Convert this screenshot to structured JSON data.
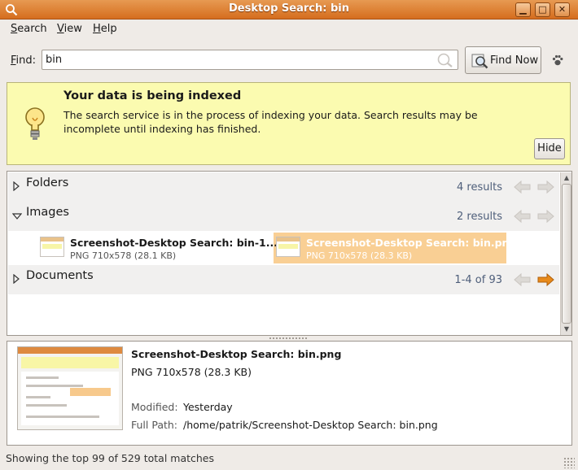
{
  "window": {
    "title": "Desktop Search: bin",
    "controls": {
      "minimize": "▁",
      "maximize": "□",
      "close": "✕"
    }
  },
  "menu": [
    {
      "label": "Search",
      "u": "S",
      "rest": "earch"
    },
    {
      "label": "View",
      "u": "V",
      "rest": "iew"
    },
    {
      "label": "Help",
      "u": "H",
      "rest": "elp"
    }
  ],
  "find": {
    "label_u": "F",
    "label_rest": "ind:",
    "value": "bin",
    "button": "Find Now"
  },
  "banner": {
    "heading": "Your data is being indexed",
    "body": "The search service is in the process of indexing your data.  Search results may be incomplete until indexing has finished.",
    "hide_button": "Hide",
    "color": "#fbfbb0"
  },
  "categories": {
    "folders": {
      "name": "Folders",
      "count": "4 results",
      "expanded": false
    },
    "images": {
      "name": "Images",
      "count": "2 results",
      "expanded": true,
      "items": [
        {
          "name": "Screenshot-Desktop Search: bin-1....",
          "meta": "PNG 710x578 (28.1 KB)",
          "selected": false
        },
        {
          "name": "Screenshot-Desktop Search: bin.png",
          "meta": "PNG 710x578 (28.3 KB)",
          "selected": true
        }
      ]
    },
    "documents": {
      "name": "Documents",
      "count": "1-4 of 93",
      "expanded": false
    }
  },
  "detail": {
    "title": "Screenshot-Desktop Search: bin.png",
    "meta": "PNG 710x578 (28.3 KB)",
    "modified_label": "Modified:",
    "modified_value": "Yesterday",
    "path_label": "Full Path:",
    "path_value": "/home/patrik/Screenshot-Desktop Search: bin.png"
  },
  "status": "Showing the top 99 of 529 total matches",
  "colors": {
    "accent": "#d56d1e",
    "selection": "#f9cf94",
    "nav_active": "#e88a1a",
    "nav_inactive": "#c9c5c0"
  }
}
